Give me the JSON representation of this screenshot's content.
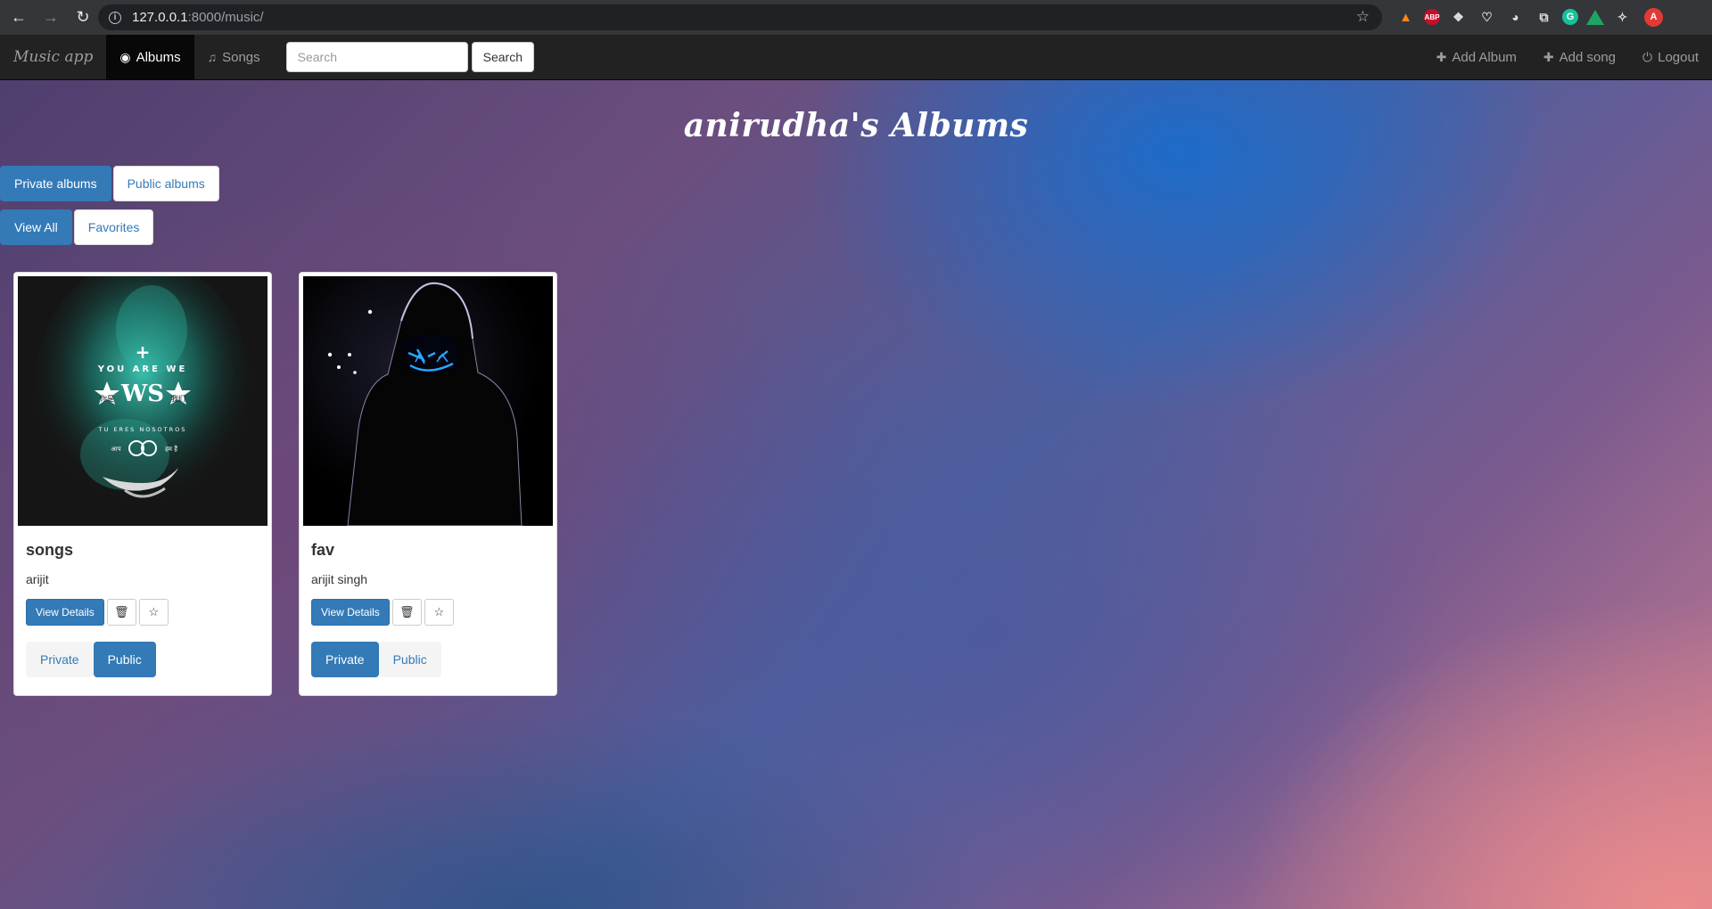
{
  "browser": {
    "url_host": "127.0.0.1",
    "url_rest": ":8000/music/",
    "profile_initial": "A",
    "extensions": [
      "metamask-icon",
      "adblock-plus-icon",
      "feedly-icon",
      "pocket-icon",
      "speedometer-icon",
      "tab-manager-icon",
      "grammarly-icon",
      "google-drive-icon",
      "extensions-puzzle-icon"
    ],
    "abp_label": "ABP",
    "grammarly_label": "G"
  },
  "navbar": {
    "brand": "Music app",
    "albums_label": "Albums",
    "songs_label": "Songs",
    "search_placeholder": "Search",
    "search_button": "Search",
    "add_album_label": "Add Album",
    "add_song_label": "Add song",
    "logout_label": "Logout"
  },
  "page": {
    "title": "anirudha's Albums",
    "filters_scope": {
      "private": "Private albums",
      "public": "Public albums",
      "active": "private"
    },
    "filters_view": {
      "all": "View All",
      "favorites": "Favorites",
      "active": "all"
    }
  },
  "albums": [
    {
      "title": "songs",
      "artist": "arijit",
      "view_details": "View Details",
      "privacy_private": "Private",
      "privacy_public": "Public",
      "visibility": "public",
      "cover_text": {
        "line1": "YOU ARE WE",
        "left": "你是",
        "right": "我们",
        "line3": "TU ERES NOSOTROS",
        "bl": "आप",
        "br": "हम हैं"
      }
    },
    {
      "title": "fav",
      "artist": "arijit singh",
      "view_details": "View Details",
      "privacy_private": "Private",
      "privacy_public": "Public",
      "visibility": "private"
    }
  ],
  "colors": {
    "primary": "#337ab7",
    "navbar": "#222222",
    "cover_teal": "#2fb3a0",
    "mask_blue": "#29a8ff"
  }
}
